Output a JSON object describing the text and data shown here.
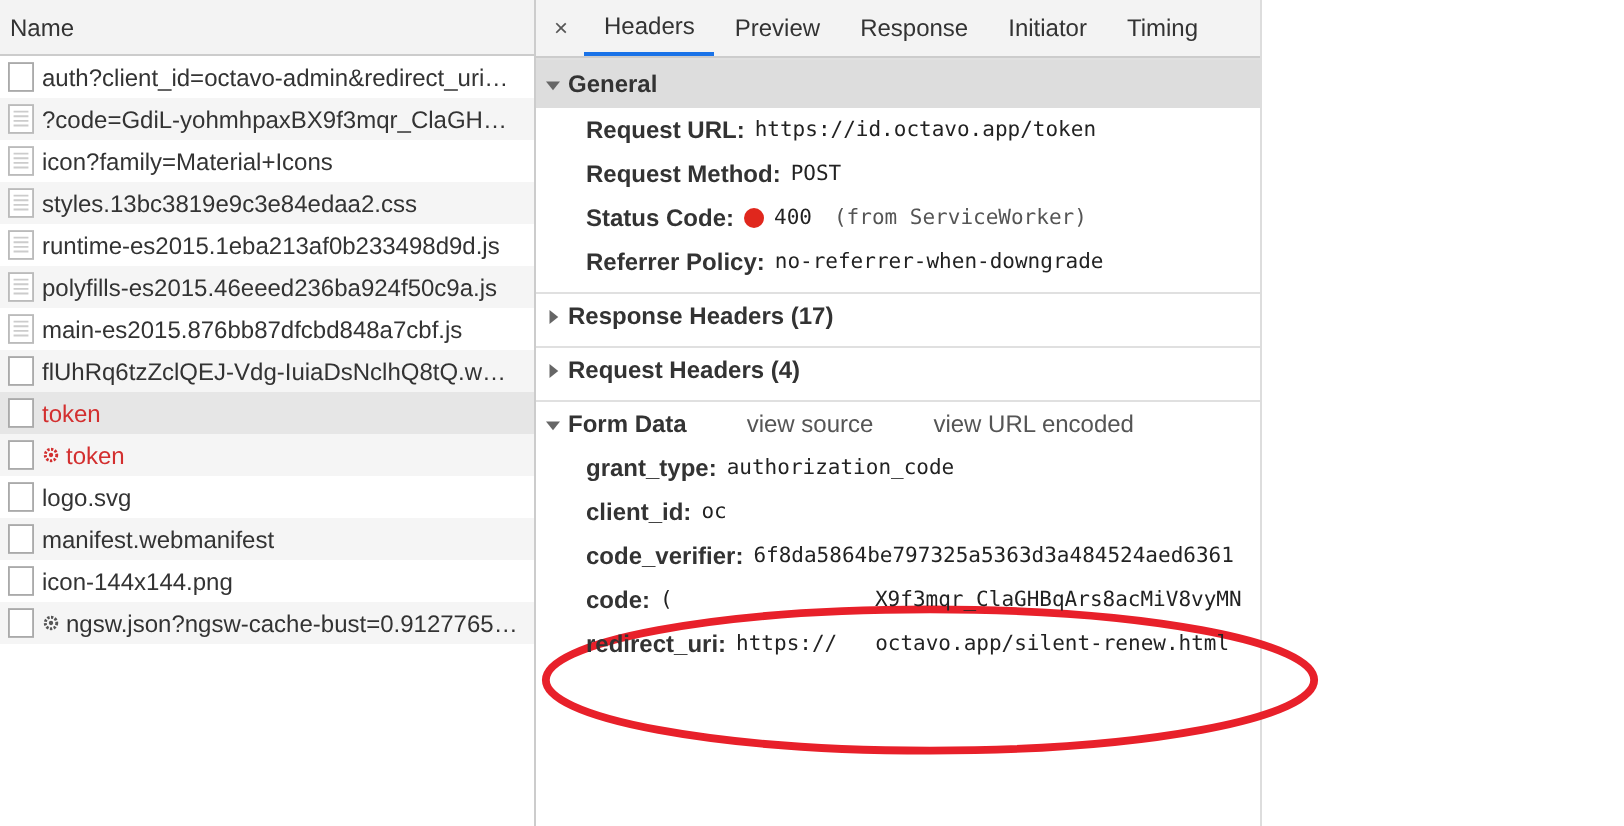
{
  "request_list": {
    "header": "Name",
    "rows": [
      {
        "name": "auth?client_id=octavo-admin&redirect_uri…",
        "kind": "blank",
        "error": false,
        "service_worker": false,
        "selected": false
      },
      {
        "name": "?code=GdiL-yohmhpaxBX9f3mqr_ClaGH…",
        "kind": "document",
        "error": false,
        "service_worker": false,
        "selected": false
      },
      {
        "name": "icon?family=Material+Icons",
        "kind": "document",
        "error": false,
        "service_worker": false,
        "selected": false
      },
      {
        "name": "styles.13bc3819e9c3e84edaa2.css",
        "kind": "document",
        "error": false,
        "service_worker": false,
        "selected": false
      },
      {
        "name": "runtime-es2015.1eba213af0b233498d9d.js",
        "kind": "document",
        "error": false,
        "service_worker": false,
        "selected": false
      },
      {
        "name": "polyfills-es2015.46eeed236ba924f50c9a.js",
        "kind": "document",
        "error": false,
        "service_worker": false,
        "selected": false
      },
      {
        "name": "main-es2015.876bb87dfcbd848a7cbf.js",
        "kind": "document",
        "error": false,
        "service_worker": false,
        "selected": false
      },
      {
        "name": "flUhRq6tzZclQEJ-Vdg-IuiaDsNclhQ8tQ.w…",
        "kind": "blank",
        "error": false,
        "service_worker": false,
        "selected": false
      },
      {
        "name": "token",
        "kind": "blank",
        "error": true,
        "service_worker": false,
        "selected": true
      },
      {
        "name": "token",
        "kind": "blank",
        "error": true,
        "service_worker": true,
        "selected": false
      },
      {
        "name": "logo.svg",
        "kind": "blank",
        "error": false,
        "service_worker": false,
        "selected": false
      },
      {
        "name": "manifest.webmanifest",
        "kind": "blank",
        "error": false,
        "service_worker": false,
        "selected": false
      },
      {
        "name": "icon-144x144.png",
        "kind": "blank",
        "error": false,
        "service_worker": false,
        "selected": false
      },
      {
        "name": "ngsw.json?ngsw-cache-bust=0.9127765…",
        "kind": "blank",
        "error": false,
        "service_worker": true,
        "selected": false
      }
    ]
  },
  "details": {
    "close": "×",
    "tabs": [
      {
        "label": "Headers",
        "selected": true
      },
      {
        "label": "Preview",
        "selected": false
      },
      {
        "label": "Response",
        "selected": false
      },
      {
        "label": "Initiator",
        "selected": false
      },
      {
        "label": "Timing",
        "selected": false
      }
    ],
    "sections": [
      {
        "title": "General",
        "expanded": true,
        "fields": [
          {
            "key": "Request URL:",
            "value": "https://id.octavo.app/token"
          },
          {
            "key": "Request Method:",
            "value": "POST"
          },
          {
            "key": "Status Code:",
            "value": "400",
            "note": "(from ServiceWorker)",
            "color": "#e0271d"
          },
          {
            "key": "Referrer Policy:",
            "value": "no-referrer-when-downgrade"
          }
        ]
      },
      {
        "title": "Response Headers (17)",
        "expanded": false
      },
      {
        "title": "Request Headers (4)",
        "expanded": false
      },
      {
        "title": "Form Data",
        "expanded": true,
        "links": [
          "view source",
          "view URL encoded"
        ],
        "fields": [
          {
            "key": "grant_type:",
            "value": "authorization_code"
          },
          {
            "key": "client_id:",
            "value": "oc"
          },
          {
            "key": "code_verifier:",
            "value": "6f8da5864be797325a5363d3a484524aed6361"
          },
          {
            "key": "code:",
            "value": "(                X9f3mqr_ClaGHBqArs8acMiV8vyMN"
          },
          {
            "key": "redirect_uri:",
            "value": "https://   octavo.app/silent-renew.html"
          }
        ]
      }
    ]
  },
  "annotation": {
    "kind": "ellipse",
    "color": "#e8202a"
  }
}
